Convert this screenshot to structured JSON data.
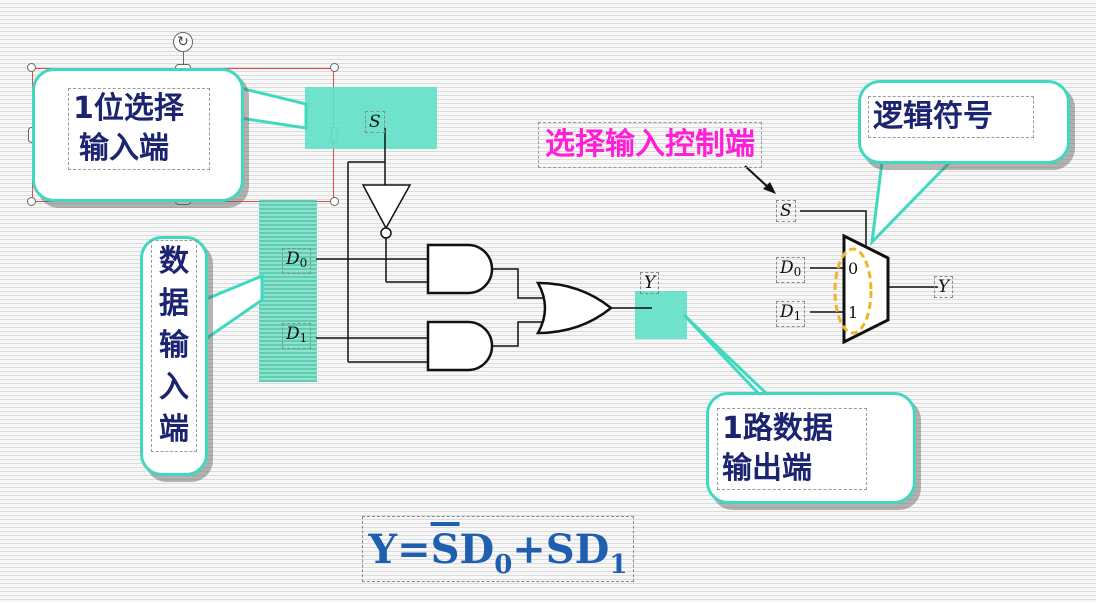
{
  "colors": {
    "callout_border": "#3fd9c0",
    "callout_text": "#1b2470",
    "highlight": "#5fe0c6",
    "formula": "#1f5fb0",
    "control_label": "#ff1fd6",
    "mux_ellipse": "#f0b429"
  },
  "callouts": {
    "select_input": [
      "1位选择",
      "输入端"
    ],
    "data_input": [
      "数",
      "据",
      "输",
      "入",
      "端"
    ],
    "data_output": [
      "1路数据",
      "输出端"
    ],
    "logic_symbol": "逻辑符号"
  },
  "control_label": "选择输入控制端",
  "circuit": {
    "s_label": "S",
    "d0_label": "D",
    "d0_sub": "0",
    "d1_label": "D",
    "d1_sub": "1",
    "y_label": "Y"
  },
  "symbol": {
    "s_label": "S",
    "d0_label": "D",
    "d0_sub": "0",
    "d1_label": "D",
    "d1_sub": "1",
    "y_label": "Y",
    "input0": "0",
    "input1": "1"
  },
  "formula": {
    "lhs": "Y=",
    "s_bar": "S",
    "term1": "D",
    "sub0": "0",
    "plus": "+SD",
    "sub1": "1"
  }
}
